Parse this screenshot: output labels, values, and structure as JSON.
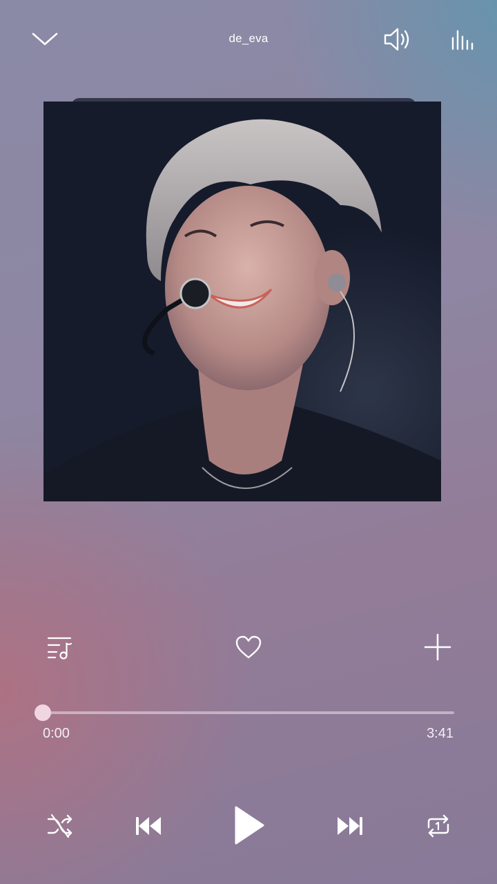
{
  "header": {
    "title": "de_eva",
    "collapse_icon": "chevron-down-icon",
    "volume_icon": "volume-icon",
    "equalizer_icon": "equalizer-icon"
  },
  "album_art": {
    "description_icon": "album-art-image"
  },
  "song": {
    "title": "",
    "artist": ""
  },
  "actions": {
    "playlist_icon": "playlist-icon",
    "favorite_icon": "heart-icon",
    "add_icon": "plus-icon"
  },
  "playback": {
    "elapsed": "0:00",
    "duration": "3:41",
    "progress_fraction": 0.0
  },
  "controls": {
    "shuffle_icon": "shuffle-icon",
    "previous_icon": "previous-icon",
    "play_icon": "play-icon",
    "next_icon": "next-icon",
    "repeat_icon": "repeat-one-icon"
  },
  "colors": {
    "accent": "#f1d6e2",
    "icon": "#ffffff"
  }
}
